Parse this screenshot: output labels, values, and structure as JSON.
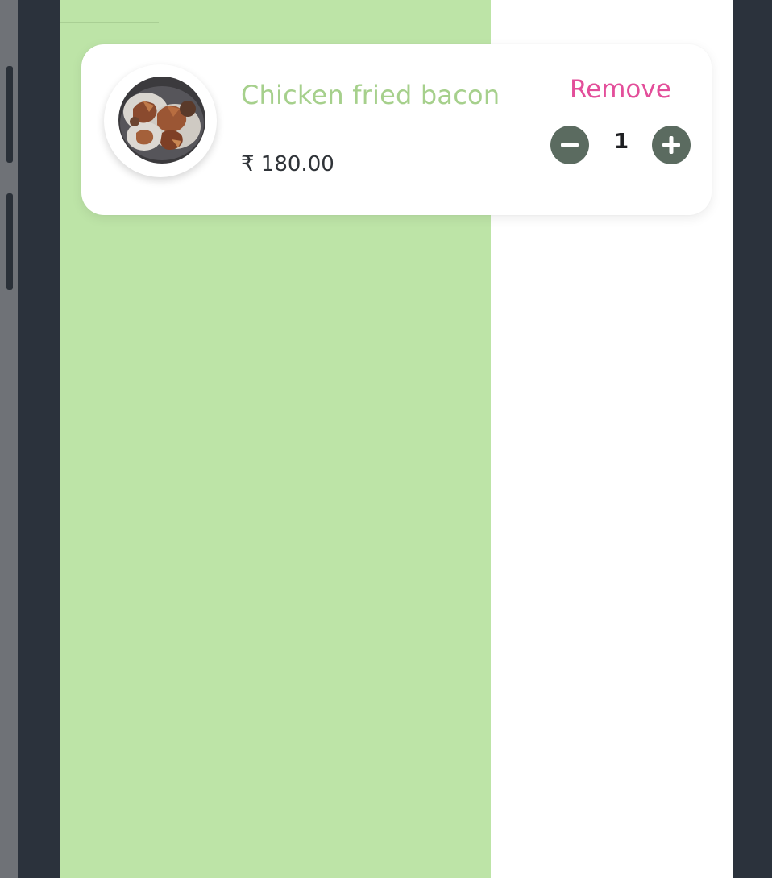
{
  "cart": {
    "items": [
      {
        "name": "Chicken fried bacon",
        "price": "₹ 180.00",
        "remove_label": "Remove",
        "quantity": "1",
        "image_icon": "food-dish-image"
      }
    ]
  },
  "controls": {
    "decrement_icon": "minus-icon",
    "increment_icon": "plus-icon"
  },
  "colors": {
    "accent_green": "#bde4a7",
    "item_name": "#a6d08c",
    "remove_pink": "#e34e9a",
    "stepper_gray": "#5b6b60",
    "device_frame": "#2b323c"
  }
}
